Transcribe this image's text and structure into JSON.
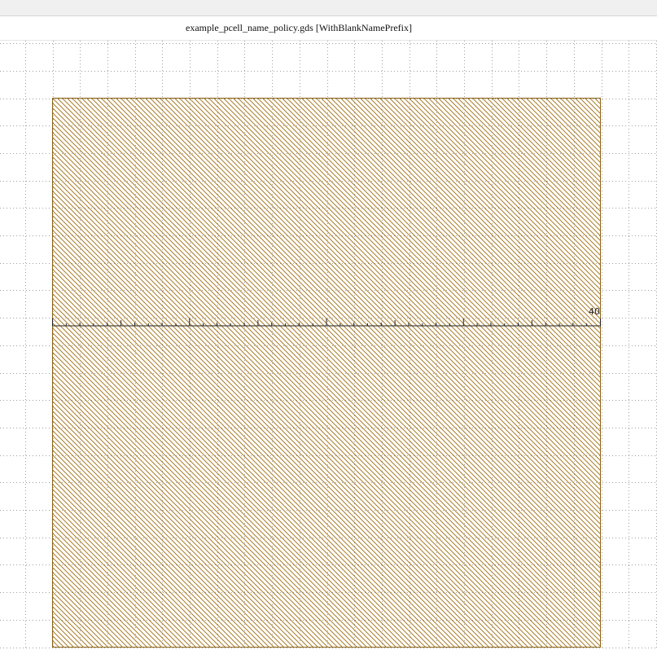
{
  "window": {
    "title": "example_pcell_name_policy.gds [WithBlankNamePrefix]"
  },
  "layout_view": {
    "shape_fill_color": "#a97c2a",
    "shape_border_color": "#8a6418",
    "grid_color": "#a0a0a0",
    "ruler_color": "#222222",
    "ruler_value": "40",
    "shape_pattern": "diagonal-hatch",
    "grid_style": "dotted"
  }
}
